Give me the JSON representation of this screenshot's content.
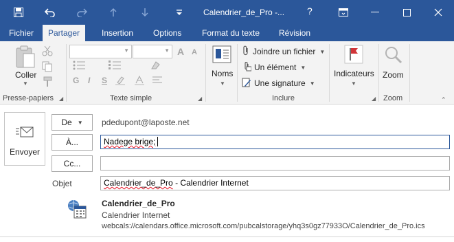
{
  "window": {
    "title": "Calendrier_de_Pro -...",
    "help": "?",
    "quick_access": [
      "save-icon",
      "undo-icon",
      "redo-icon",
      "previous-item-icon",
      "next-item-icon",
      "customize-icon"
    ],
    "accent_color": "#2b579a"
  },
  "tabs": [
    {
      "label": "Fichier"
    },
    {
      "label": "Partager"
    },
    {
      "label": "Insertion"
    },
    {
      "label": "Options"
    },
    {
      "label": "Format du texte"
    },
    {
      "label": "Révision"
    }
  ],
  "active_tab": "Partager",
  "ribbon": {
    "clipboard": {
      "paste_label": "Coller",
      "group_label": "Presse-papiers"
    },
    "basic_text": {
      "group_label": "Texte simple",
      "font_name": "",
      "font_size": "",
      "grow": "A",
      "shrink": "A",
      "bold": "G",
      "italic": "I",
      "underline": "S"
    },
    "names": {
      "label": "Noms"
    },
    "include": {
      "group_label": "Inclure",
      "attach_file": "Joindre un fichier",
      "item": "Un élément",
      "signature": "Une signature"
    },
    "tags": {
      "label": "Indicateurs"
    },
    "zoom": {
      "label": "Zoom",
      "group_label": "Zoom"
    }
  },
  "compose": {
    "send_label": "Envoyer",
    "from_button": "De",
    "from_value": "pdedupont@laposte.net",
    "to_button": "À...",
    "to_value": "Nadege brige;",
    "cc_button": "Cc...",
    "cc_value": "",
    "subject_label": "Objet",
    "subject_value_part1": "Calendrier_de_Pro",
    "subject_value_part2": " - Calendrier Internet"
  },
  "attachment": {
    "title": "Calendrier_de_Pro",
    "subtitle": "Calendrier Internet",
    "url": "webcals://calendars.office.microsoft.com/pubcalstorage/yhq3s0gz77933O/Calendrier_de_Pro.ics"
  }
}
